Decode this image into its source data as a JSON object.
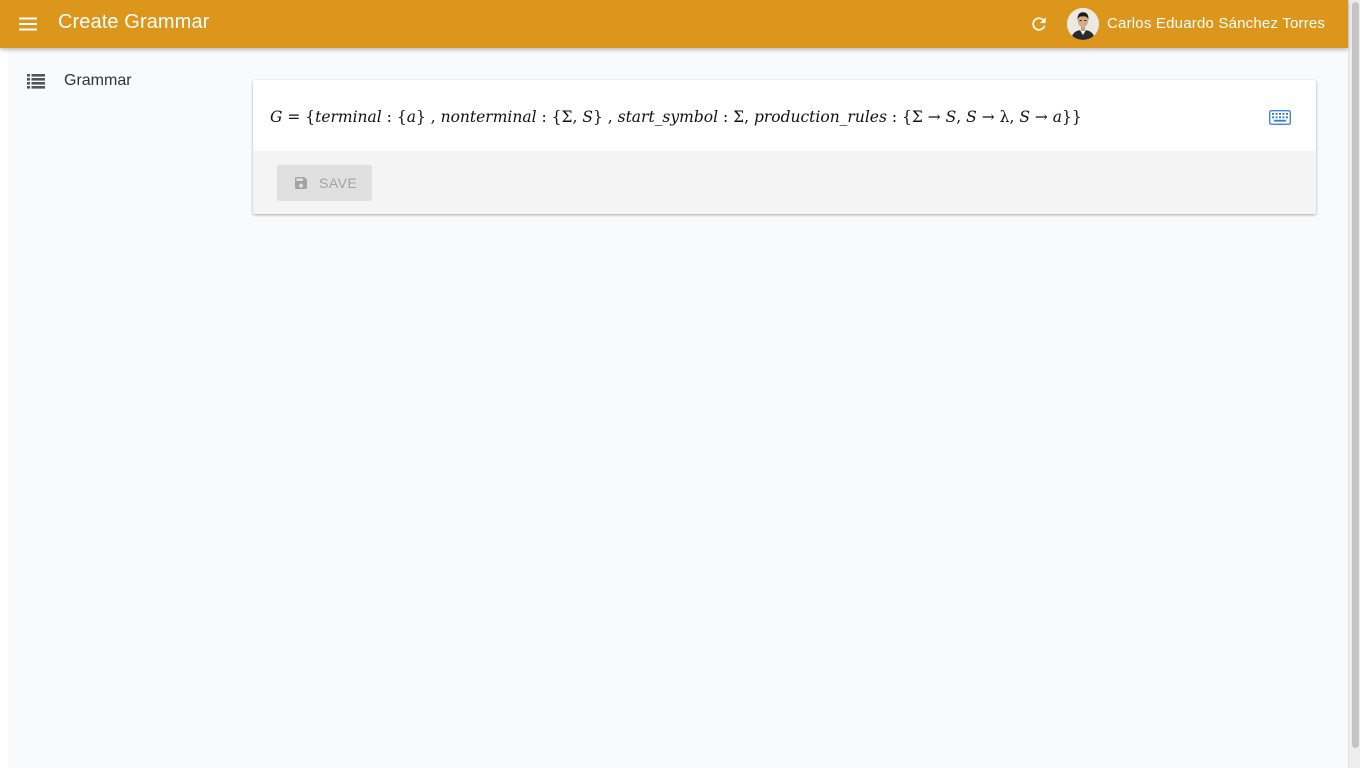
{
  "app": {
    "title": "Create Grammar",
    "user_name": "Carlos Eduardo Sánchez Torres",
    "accent_color": "#dd961c"
  },
  "toolbar": {
    "menu_icon": "menu-icon",
    "refresh_icon": "refresh-icon",
    "avatar_icon": "user-avatar"
  },
  "sidebar": {
    "items": [
      {
        "label": "Grammar",
        "icon": "list-icon"
      }
    ]
  },
  "grammar": {
    "formula_parts": [
      {
        "text": "G",
        "italic": true
      },
      {
        "text": " = {",
        "italic": false
      },
      {
        "text": "terminal",
        "italic": true
      },
      {
        "text": " : {",
        "italic": false
      },
      {
        "text": "a",
        "italic": true
      },
      {
        "text": "} , ",
        "italic": false
      },
      {
        "text": "nonterminal",
        "italic": true
      },
      {
        "text": " : {Σ, ",
        "italic": false
      },
      {
        "text": "S",
        "italic": true
      },
      {
        "text": "} , ",
        "italic": false
      },
      {
        "text": "start_symbol",
        "italic": true
      },
      {
        "text": " : Σ, ",
        "italic": false
      },
      {
        "text": "production_rules",
        "italic": true
      },
      {
        "text": " : {Σ → ",
        "italic": false
      },
      {
        "text": "S",
        "italic": true
      },
      {
        "text": ", ",
        "italic": false
      },
      {
        "text": "S",
        "italic": true
      },
      {
        "text": " → λ, ",
        "italic": false
      },
      {
        "text": "S",
        "italic": true
      },
      {
        "text": " → ",
        "italic": false
      },
      {
        "text": "a",
        "italic": true
      },
      {
        "text": "}}",
        "italic": false
      }
    ],
    "keyboard_icon": "keyboard-icon",
    "save_label": "SAVE",
    "save_icon": "save-icon",
    "save_disabled": true
  }
}
